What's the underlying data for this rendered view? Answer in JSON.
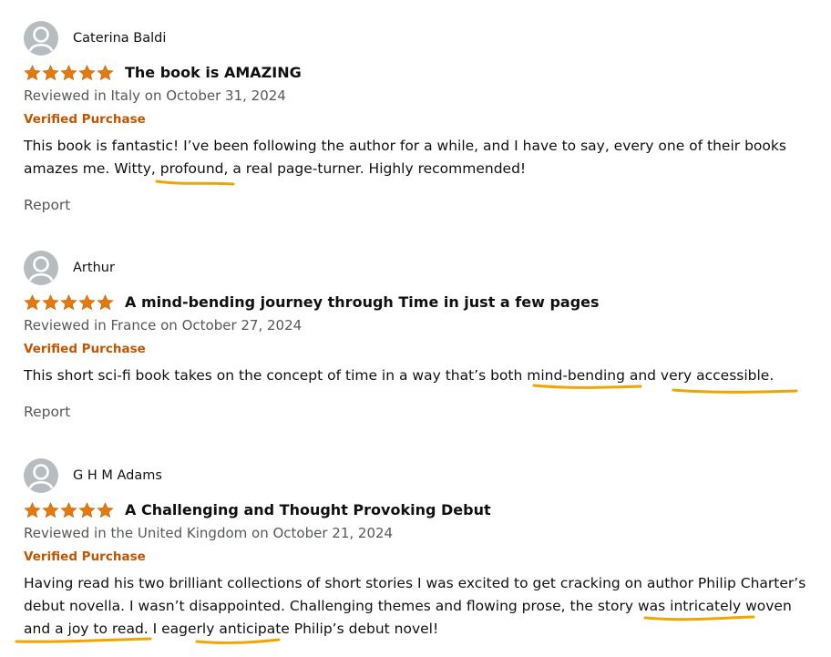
{
  "colors": {
    "star": "#e47911",
    "verified": "#c45500",
    "underline": "#f0a500"
  },
  "reviews": [
    {
      "name": "Caterina Baldi",
      "rating": 5,
      "title": "The book is AMAZING",
      "meta": "Reviewed in Italy on October 31, 2024",
      "verified": "Verified Purchase",
      "body": "This book is fantastic! I’ve been following the author for a while, and I have to say, every one of their books amazes me. Witty, profound, a real page-turner. Highly recommended!",
      "report": "Report"
    },
    {
      "name": "Arthur",
      "rating": 5,
      "title": "A mind-bending journey through Time in just a few pages",
      "meta": "Reviewed in France on October 27, 2024",
      "verified": "Verified Purchase",
      "body": "This short sci-fi book takes on the concept of time in a way that’s both mind-bending and very accessible.",
      "report": "Report"
    },
    {
      "name": "G H M Adams",
      "rating": 5,
      "title": "A Challenging and Thought Provoking Debut",
      "meta": "Reviewed in the United Kingdom on October 21, 2024",
      "verified": "Verified Purchase",
      "body": "Having read his two brilliant collections of short stories I was excited to get cracking on author Philip Charter’s debut novella. I wasn’t disappointed. Challenging themes and flowing prose, the story was intricately woven and a joy to read. I eagerly anticipate Philip’s debut novel!"
    }
  ]
}
